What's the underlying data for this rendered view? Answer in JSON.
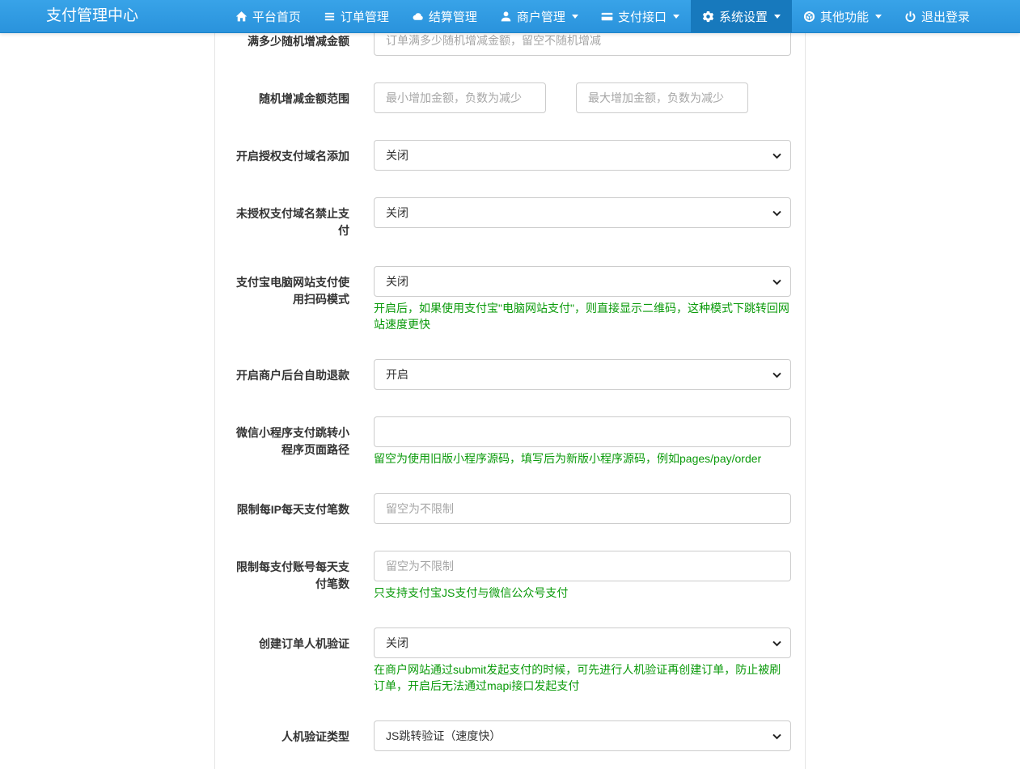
{
  "brand": "支付管理中心",
  "colors": {
    "nav_blue": "#2b96dd",
    "nav_active_blue": "#1779bd",
    "help_green": "#0a9a0a",
    "input_border": "#cccccc"
  },
  "nav": {
    "items": [
      {
        "label": "平台首页",
        "icon": "home-icon",
        "caret": false,
        "active": false
      },
      {
        "label": "订单管理",
        "icon": "list-icon",
        "caret": false,
        "active": false
      },
      {
        "label": "结算管理",
        "icon": "cloud-icon",
        "caret": false,
        "active": false
      },
      {
        "label": "商户管理",
        "icon": "user-icon",
        "caret": true,
        "active": false
      },
      {
        "label": "支付接口",
        "icon": "credit-card-icon",
        "caret": true,
        "active": false
      },
      {
        "label": "系统设置",
        "icon": "gear-icon",
        "caret": true,
        "active": true
      },
      {
        "label": "其他功能",
        "icon": "cube-icon",
        "caret": true,
        "active": false
      },
      {
        "label": "退出登录",
        "icon": "power-icon",
        "caret": false,
        "active": false
      }
    ]
  },
  "form": {
    "fields": [
      {
        "label": "满多少随机增减金额",
        "type": "text",
        "value": "",
        "placeholder": "订单满多少随机增减金额，留空不随机增减"
      },
      {
        "label": "随机增减金额范围",
        "type": "text-pair",
        "placeholders": [
          "最小增加金额，负数为减少",
          "最大增加金额，负数为减少"
        ]
      },
      {
        "label": "开启授权支付域名添加",
        "type": "select",
        "value": "关闭"
      },
      {
        "label": "未授权支付域名禁止支付",
        "type": "select",
        "value": "关闭"
      },
      {
        "label": "支付宝电脑网站支付使用扫码模式",
        "type": "select",
        "value": "关闭",
        "help": "开启后，如果使用支付宝\"电脑网站支付\"，则直接显示二维码，这种模式下跳转回网站速度更快"
      },
      {
        "label": "开启商户后台自助退款",
        "type": "select",
        "value": "开启"
      },
      {
        "label": "微信小程序支付跳转小程序页面路径",
        "type": "text",
        "value": "",
        "placeholder": "",
        "help": "留空为使用旧版小程序源码，填写后为新版小程序源码，例如pages/pay/order"
      },
      {
        "label": "限制每IP每天支付笔数",
        "type": "text",
        "value": "",
        "placeholder": "留空为不限制"
      },
      {
        "label": "限制每支付账号每天支付笔数",
        "type": "text",
        "value": "",
        "placeholder": "留空为不限制",
        "help": "只支持支付宝JS支付与微信公众号支付"
      },
      {
        "label": "创建订单人机验证",
        "type": "select",
        "value": "关闭",
        "help": "在商户网站通过submit发起支付的时候，可先进行人机验证再创建订单，防止被刷订单，开启后无法通过mapi接口发起支付"
      },
      {
        "label": "人机验证类型",
        "type": "select",
        "value": "JS跳转验证（速度快）"
      }
    ]
  }
}
